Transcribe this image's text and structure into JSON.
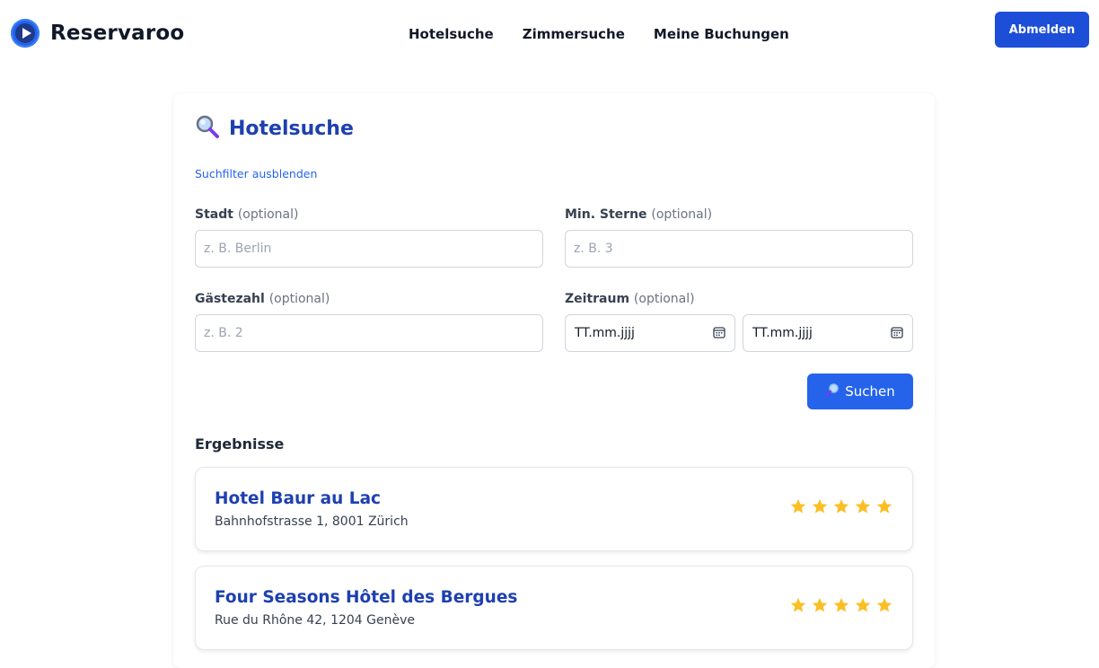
{
  "app": {
    "name": "Reservaroo"
  },
  "nav": {
    "items": [
      {
        "label": "Hotelsuche"
      },
      {
        "label": "Zimmersuche"
      },
      {
        "label": "Meine Buchungen"
      }
    ],
    "logout_label": "Abmelden"
  },
  "search": {
    "title": "Hotelsuche",
    "title_icon": "magnifier-icon",
    "filter_toggle_label": "Suchfilter ausblenden",
    "fields": {
      "city": {
        "label": "Stadt",
        "optional": "(optional)",
        "placeholder": "z. B. Berlin",
        "value": ""
      },
      "stars": {
        "label": "Min. Sterne",
        "optional": "(optional)",
        "placeholder": "z. B. 3",
        "value": ""
      },
      "guests": {
        "label": "Gästezahl",
        "optional": "(optional)",
        "placeholder": "z. B. 2",
        "value": ""
      },
      "period": {
        "label": "Zeitraum",
        "optional": "(optional)",
        "from": "TT.mm.jjjj",
        "to": "TT.mm.jjjj"
      }
    },
    "submit_label": "Suchen"
  },
  "results": {
    "heading": "Ergebnisse",
    "items": [
      {
        "name": "Hotel Baur au Lac",
        "address": "Bahnhofstrasse 1, 8001 Zürich",
        "stars": 5
      },
      {
        "name": "Four Seasons Hôtel des Bergues",
        "address": "Rue du Rhône 42, 1204 Genève",
        "stars": 5
      }
    ]
  },
  "colors": {
    "primary": "#2563eb",
    "primary_dark": "#1d4ed8",
    "title": "#1e40af",
    "star": "#fbbf24"
  }
}
